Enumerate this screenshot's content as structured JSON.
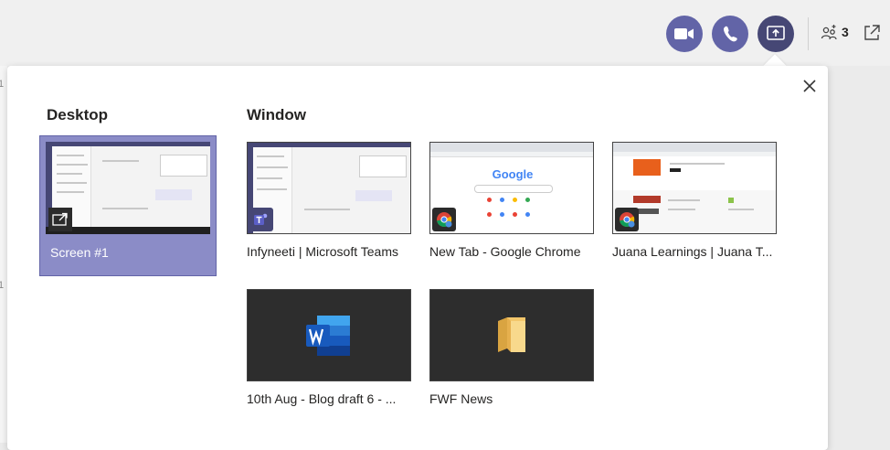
{
  "header": {
    "participant_count": "3"
  },
  "panel": {
    "desktop_title": "Desktop",
    "window_title": "Window",
    "screens": [
      {
        "label": "Screen #1",
        "selected": true
      }
    ],
    "windows": [
      {
        "label": "Infyneeti | Microsoft Teams",
        "app_icon": "teams-icon"
      },
      {
        "label": "New Tab - Google Chrome",
        "app_icon": "chrome-icon",
        "thumb_text": "Google"
      },
      {
        "label": "Juana Learnings | Juana T...",
        "app_icon": "chrome-icon"
      },
      {
        "label": "10th Aug - Blog draft 6 - ...",
        "app_icon": "word-icon"
      },
      {
        "label": "FWF News",
        "app_icon": "folder-icon"
      }
    ]
  },
  "colors": {
    "accent": "#6264a7",
    "share_active": "#464775",
    "selected_tile": "#8b8cc7"
  }
}
